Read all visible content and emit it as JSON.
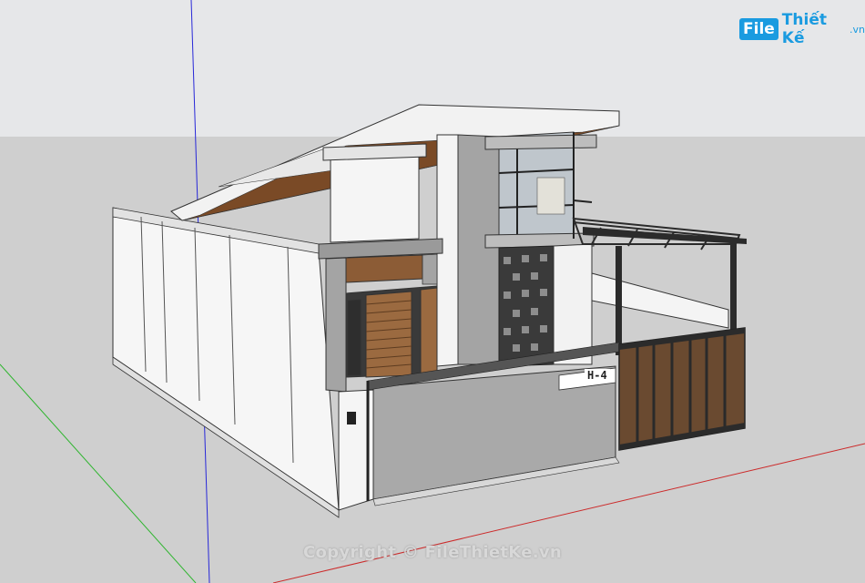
{
  "watermark": {
    "logo_box": "File",
    "logo_text": "Thiết Kế",
    "logo_suffix": ".vn",
    "copyright": "Copyright © FileThietKe.vn",
    "brand_color": "#1a9be0"
  },
  "model": {
    "house_number": "H-4"
  },
  "colors": {
    "sky": "#e6e7e9",
    "ground": "#cfcfcf",
    "wall_white": "#f4f4f4",
    "wall_grey": "#9e9e9e",
    "wood": "#8a5a33",
    "steel": "#2b2b2b"
  }
}
